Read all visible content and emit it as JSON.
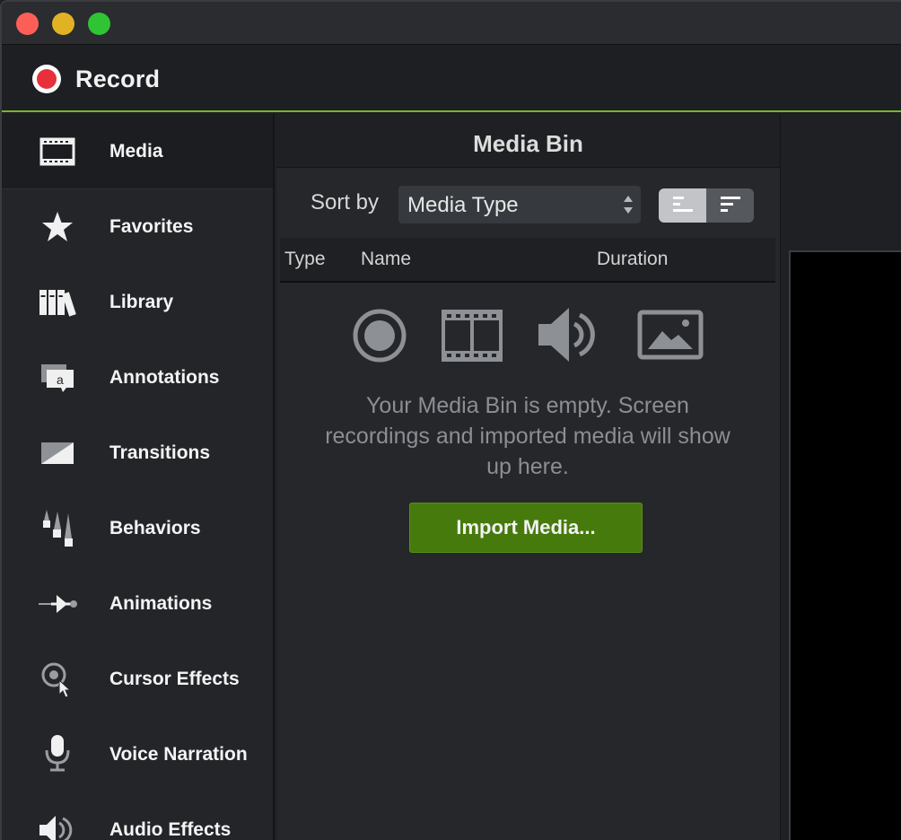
{
  "window": {
    "controls": [
      "close",
      "minimize",
      "maximize"
    ],
    "colors": {
      "close": "#fd5f57",
      "minimize": "#e1b324",
      "maximize": "#2fc434"
    }
  },
  "toolbar": {
    "record_label": "Record",
    "accent_color": "#7ab62f"
  },
  "sidebar": {
    "items": [
      {
        "label": "Media",
        "icon": "film-strip-icon"
      },
      {
        "label": "Favorites",
        "icon": "star-icon"
      },
      {
        "label": "Library",
        "icon": "books-icon"
      },
      {
        "label": "Annotations",
        "icon": "annotation-callout-icon"
      },
      {
        "label": "Transitions",
        "icon": "transition-icon"
      },
      {
        "label": "Behaviors",
        "icon": "behaviors-icon"
      },
      {
        "label": "Animations",
        "icon": "animation-arrow-icon"
      },
      {
        "label": "Cursor Effects",
        "icon": "cursor-effect-icon"
      },
      {
        "label": "Voice Narration",
        "icon": "microphone-icon"
      },
      {
        "label": "Audio Effects",
        "icon": "speaker-icon"
      }
    ],
    "active": "Media"
  },
  "media_bin": {
    "title": "Media Bin",
    "sort_label": "Sort by",
    "sort_value": "Media Type",
    "columns": {
      "type": "Type",
      "name": "Name",
      "duration": "Duration"
    },
    "empty_icons": [
      "record-icon",
      "film-strip-icon",
      "audio-icon",
      "image-icon"
    ],
    "empty_message": "Your Media Bin is empty. Screen recordings and imported media will show up here.",
    "import_label": "Import Media...",
    "import_color": "#467a0c"
  }
}
